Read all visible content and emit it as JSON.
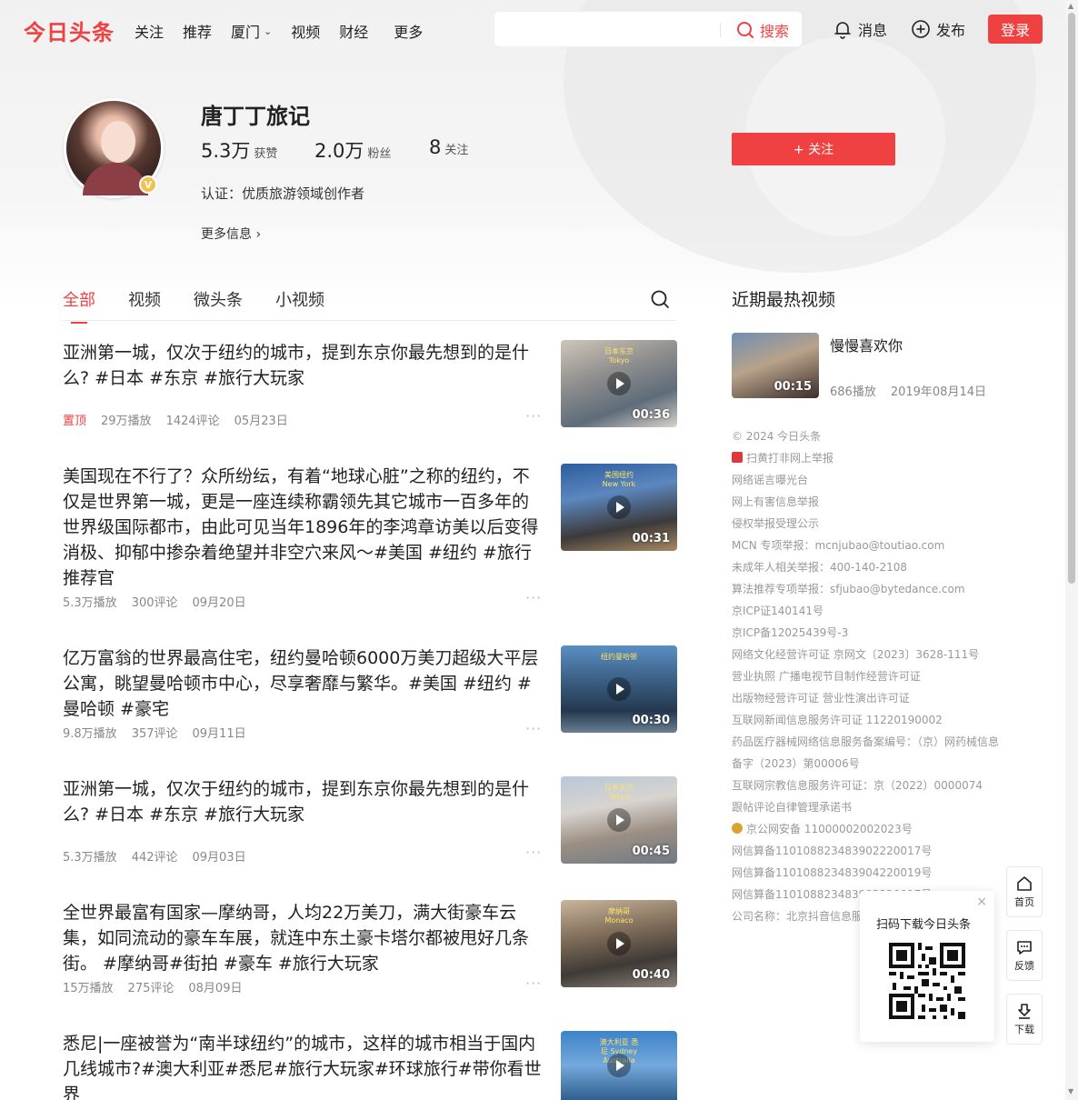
{
  "header": {
    "logo": "今日头条",
    "nav": [
      "关注",
      "推荐",
      "厦门",
      "视频",
      "财经"
    ],
    "nav_more": "更多",
    "search_placeholder": "",
    "search_button": "搜索",
    "messages": "消息",
    "publish": "发布",
    "login": "登录"
  },
  "profile": {
    "name": "唐丁丁旅记",
    "likes_num": "5.3万",
    "likes_label": "获赞",
    "fans_num": "2.0万",
    "fans_label": "粉丝",
    "following_num": "8",
    "following_label": "关注",
    "certification": "认证：优质旅游领域创作者",
    "more_info": "更多信息",
    "follow_button": "+ 关注"
  },
  "tabs": [
    "全部",
    "视频",
    "微头条",
    "小视频"
  ],
  "feed": [
    {
      "title": "亚洲第一城，仅次于纽约的城市，提到东京你最先想到的是什么? #日本 #东京 #旅行大玩家",
      "pinned": "置顶",
      "plays": "29万播放",
      "comments": "1424评论",
      "date": "05月23日",
      "duration": "00:36",
      "thumb_caption": "日本东京 Tokyo"
    },
    {
      "title": "美国现在不行了？众所纷纭，有着“地球心脏”之称的纽约，不仅是世界第一城，更是一座连续称霸领先其它城市一百多年的世界级国际都市，由此可见当年1896年的李鸿章访美以后变得消极、抑郁中掺杂着绝望并非空穴来风～#美国 #纽约 #旅行推荐官",
      "pinned": "",
      "plays": "5.3万播放",
      "comments": "300评论",
      "date": "09月20日",
      "duration": "00:31",
      "thumb_caption": "美国纽约 New York"
    },
    {
      "title": "亿万富翁的世界最高住宅，纽约曼哈顿6000万美刀超级大平层公寓，眺望曼哈顿市中心，尽享奢靡与繁华。#美国 #纽约 #曼哈顿 #豪宅",
      "pinned": "",
      "plays": "9.8万播放",
      "comments": "357评论",
      "date": "09月11日",
      "duration": "00:30",
      "thumb_caption": "纽约曼哈顿"
    },
    {
      "title": "亚洲第一城，仅次于纽约的城市，提到东京你最先想到的是什么? #日本 #东京 #旅行大玩家",
      "pinned": "",
      "plays": "5.3万播放",
      "comments": "442评论",
      "date": "09月03日",
      "duration": "00:45",
      "thumb_caption": "日本东京 Tokyo"
    },
    {
      "title": "全世界最富有国家—摩纳哥，人均22万美刀，满大街豪车云集，如同流动的豪车车展，就连中东土豪卡塔尔都被甩好几条街。 #摩纳哥#街拍 #豪车 #旅行大玩家",
      "pinned": "",
      "plays": "15万播放",
      "comments": "275评论",
      "date": "08月09日",
      "duration": "00:40",
      "thumb_caption": "摩纳哥 Monaco"
    },
    {
      "title": "悉尼|一座被誉为“南半球纽约”的城市，这样的城市相当于国内几线城市?#澳大利亚#悉尼#旅行大玩家#环球旅行#带你看世界",
      "pinned": "",
      "plays": "",
      "comments": "",
      "date": "",
      "duration": "",
      "thumb_caption": "澳大利亚 悉尼 Sydney Australia"
    }
  ],
  "sidebar": {
    "title": "近期最热视频",
    "hot": {
      "title": "慢慢喜欢你",
      "duration": "00:15",
      "plays": "686播放",
      "date": "2019年08月14日"
    },
    "footer": [
      "© 2024 今日头条",
      "扫黄打非网上举报",
      "网络谣言曝光台",
      "网上有害信息举报",
      "侵权举报受理公示",
      "MCN 专项举报：mcnjubao@toutiao.com",
      "未成年人相关举报：400-140-2108",
      "算法推荐专项举报：sfjubao@bytedance.com",
      "京ICP证140141号",
      "京ICP备12025439号-3",
      "网络文化经营许可证 京网文〔2023〕3628-111号",
      "营业执照 广播电视节目制作经营许可证",
      "出版物经营许可证 营业性演出许可证",
      "互联网新闻信息服务许可证 11220190002",
      "药品医疗器械网络信息服务备案编号：（京）网药械信息",
      "备字（2023）第00006号",
      "互联网宗教信息服务许可证：京（2022）0000074",
      "跟帖评论自律管理承诺书",
      "京公网安备 11000002002023号",
      "网信算备110108823483902220017号",
      "网信算备110108823483904220019号",
      "网信算备110108823483903220017号",
      "公司名称：北京抖音信息服务有限公司"
    ]
  },
  "qr": {
    "title": "扫码下载今日头条",
    "close": "×"
  },
  "float_tools": {
    "home": "首页",
    "feedback": "反馈",
    "download": "下载"
  },
  "colors": {
    "brand": "#f04142",
    "text": "#222222",
    "meta": "#888888"
  }
}
